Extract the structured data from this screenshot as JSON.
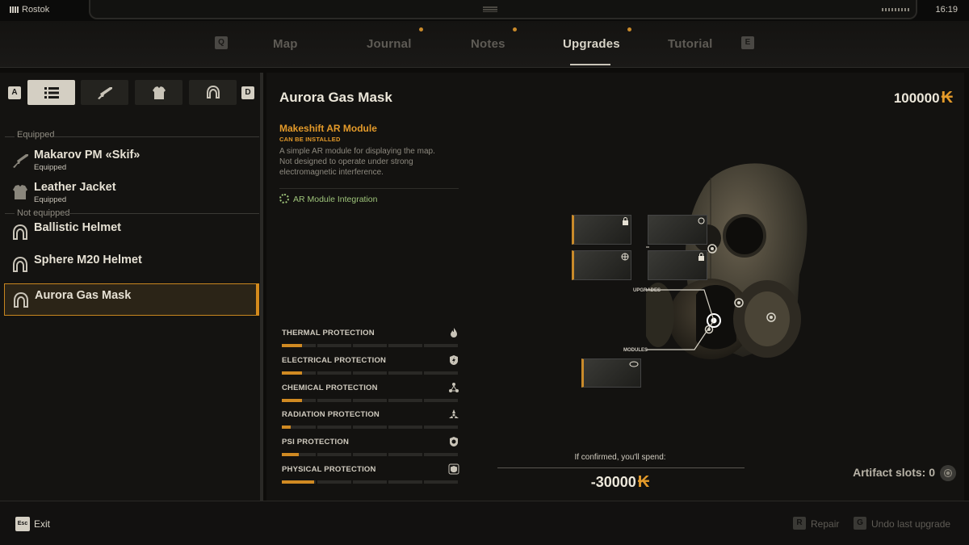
{
  "status": {
    "location": "Rostok",
    "time": "16:19"
  },
  "tabs": {
    "prev_key": "Q",
    "next_key": "E",
    "items": [
      {
        "label": "Map"
      },
      {
        "label": "Journal"
      },
      {
        "label": "Notes"
      },
      {
        "label": "Upgrades"
      },
      {
        "label": "Tutorial"
      }
    ],
    "active": "Upgrades"
  },
  "inventory": {
    "filter_prev_key": "A",
    "filter_next_key": "D",
    "filters": [
      "all-list-icon",
      "rifle-icon",
      "armor-icon",
      "helmet-icon"
    ],
    "equipped_label": "Equipped",
    "not_equipped_label": "Not equipped",
    "items": [
      {
        "name": "Makarov PM «Skif»",
        "sub": "Equipped",
        "icon": "pistol-icon"
      },
      {
        "name": "Leather Jacket",
        "sub": "Equipped",
        "icon": "jacket-icon"
      },
      {
        "name": "Ballistic Helmet",
        "sub": "",
        "icon": "helmet-icon"
      },
      {
        "name": "Sphere M20 Helmet",
        "sub": "",
        "icon": "helmet-icon"
      },
      {
        "name": "Aurora Gas Mask",
        "sub": "",
        "icon": "helmet-icon",
        "selected": true
      }
    ]
  },
  "detail": {
    "title": "Aurora Gas Mask",
    "money": "100000",
    "module_name": "Makeshift AR Module",
    "module_status": "CAN BE INSTALLED",
    "module_desc": "A simple AR module for displaying the map. Not designed to operate under strong electromagnetic interference.",
    "integration": "AR Module Integration",
    "upgrades_label": "UPGRADES",
    "modules_label": "MODULES",
    "stats": [
      {
        "label": "THERMAL PROTECTION",
        "icon": "flame-icon",
        "value": 0.12
      },
      {
        "label": "ELECTRICAL PROTECTION",
        "icon": "lightning-shield-icon",
        "value": 0.12
      },
      {
        "label": "CHEMICAL PROTECTION",
        "icon": "chemical-icon",
        "value": 0.12
      },
      {
        "label": "RADIATION PROTECTION",
        "icon": "radiation-icon",
        "value": 0.05
      },
      {
        "label": "PSI PROTECTION",
        "icon": "psi-icon",
        "value": 0.1
      },
      {
        "label": "PHYSICAL PROTECTION",
        "icon": "physical-shield-icon",
        "value": 0.19
      }
    ],
    "spend_label": "If confirmed, you'll spend:",
    "spend_value": "-30000",
    "artifact_label": "Artifact slots: 0"
  },
  "footer": {
    "exit_key": "Esc",
    "exit_label": "Exit",
    "repair_key": "R",
    "repair_label": "Repair",
    "undo_key": "G",
    "undo_label": "Undo last upgrade"
  },
  "colors": {
    "accent": "#d08a22",
    "positive": "#9ec47a"
  }
}
